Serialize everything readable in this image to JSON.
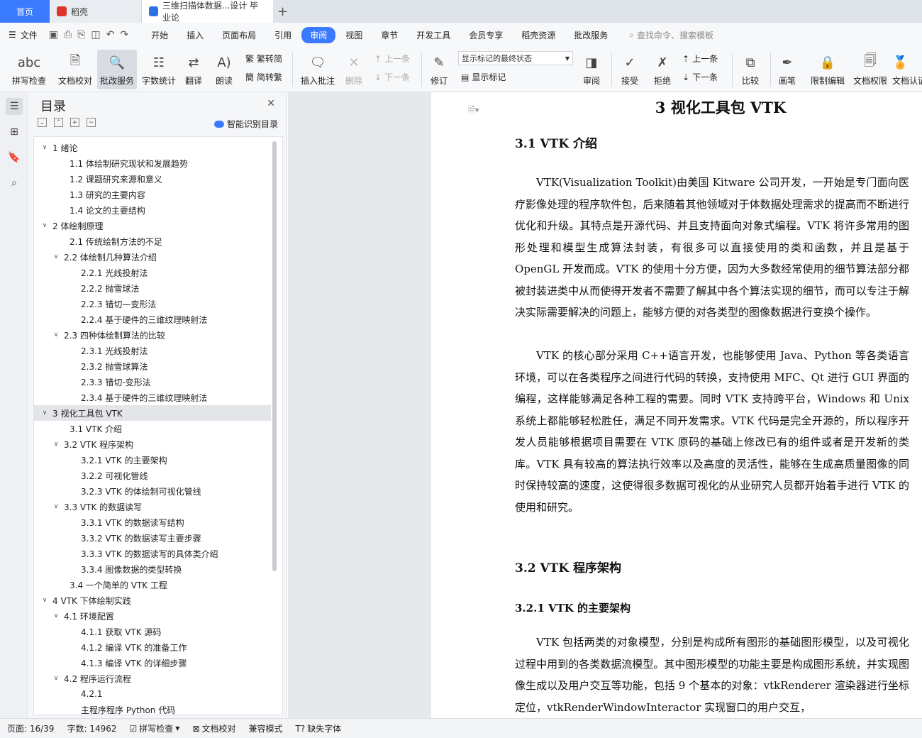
{
  "tabs": {
    "home": "首页",
    "daoke": "稻壳",
    "doc": "三维扫描体数据...设计 毕业论"
  },
  "menu": {
    "file": "文件",
    "items": [
      "开始",
      "插入",
      "页面布局",
      "引用",
      "审阅",
      "视图",
      "章节",
      "开发工具",
      "会员专享",
      "稻壳资源",
      "批改服务"
    ],
    "search": "查找命令、搜索模板"
  },
  "ribbon": {
    "spellcheck": "拼写检查",
    "proofread": "文档校对",
    "grading": "批改服务",
    "wordcount": "字数统计",
    "translate": "翻译",
    "read": "朗读",
    "trad": "繁转简",
    "simp": "简转繁",
    "add_comment": "插入批注",
    "delete": "删除",
    "prev_c": "上一条",
    "next_c": "下一条",
    "revise": "修订",
    "markup_select": "显示标记的最终状态",
    "show_markup": "显示标记",
    "review": "审阅",
    "accept": "接受",
    "reject": "拒绝",
    "prev": "上一条",
    "next": "下一条",
    "compare": "比较",
    "pen": "画笔",
    "restrict": "限制编辑",
    "permission": "文档权限",
    "certify": "文档认证"
  },
  "toc": {
    "title": "目录",
    "smart": "智能识别目录",
    "items": [
      {
        "level": 1,
        "text": "1  绪论",
        "arrow": true
      },
      {
        "level": 2,
        "text": "1.1  体绘制研究现状和发展趋势"
      },
      {
        "level": 2,
        "text": "1.2  课题研究来源和意义"
      },
      {
        "level": 2,
        "text": "1.3  研究的主要内容"
      },
      {
        "level": 2,
        "text": "1.4  论文的主要结构"
      },
      {
        "level": 1,
        "text": "2  体绘制原理",
        "arrow": true
      },
      {
        "level": 2,
        "text": "2.1 传统绘制方法的不足"
      },
      {
        "level": 2,
        "text": "2.2  体绘制几种算法介绍",
        "arrow": true
      },
      {
        "level": 3,
        "text": "2.2.1  光线投射法"
      },
      {
        "level": 3,
        "text": "2.2.2  抛雪球法"
      },
      {
        "level": 3,
        "text": "2.2.3  错切—变形法"
      },
      {
        "level": 3,
        "text": "2.2.4 基于硬件的三维纹理映射法"
      },
      {
        "level": 2,
        "text": "2.3  四种体绘制算法的比较",
        "arrow": true
      },
      {
        "level": 3,
        "text": "2.3.1  光线投射法"
      },
      {
        "level": 3,
        "text": "2.3.2  抛雪球算法"
      },
      {
        "level": 3,
        "text": "2.3.3  错切-变形法"
      },
      {
        "level": 3,
        "text": "2.3.4  基于硬件的三维纹理映射法"
      },
      {
        "level": 1,
        "text": "3  视化工具包 VTK",
        "arrow": true,
        "selected": true
      },
      {
        "level": 2,
        "text": "3.1 VTK 介绍"
      },
      {
        "level": 2,
        "text": "3.2 VTK 程序架构",
        "arrow": true
      },
      {
        "level": 3,
        "text": "3.2.1 VTK 的主要架构"
      },
      {
        "level": 3,
        "text": "3.2.2  可视化管线"
      },
      {
        "level": 3,
        "text": "3.2.3 VTK 的体绘制可视化管线"
      },
      {
        "level": 2,
        "text": "3.3 VTK 的数据读写",
        "arrow": true
      },
      {
        "level": 3,
        "text": "3.3.1 VTK 的数据读写结构"
      },
      {
        "level": 3,
        "text": "3.3.2 VTK 的数据读写主要步骤"
      },
      {
        "level": 3,
        "text": "3.3.3 VTK 的数据读写的具体类介绍"
      },
      {
        "level": 3,
        "text": "3.3.4  图像数据的类型转换"
      },
      {
        "level": 2,
        "text": "3.4  一个简单的 VTK 工程"
      },
      {
        "level": 1,
        "text": "4 VTK 下体绘制实践",
        "arrow": true
      },
      {
        "level": 2,
        "text": "4.1  环境配置",
        "arrow": true
      },
      {
        "level": 3,
        "text": "4.1.1  获取 VTK 源码"
      },
      {
        "level": 3,
        "text": "4.1.2  编译 VTK 的准备工作"
      },
      {
        "level": 3,
        "text": "4.1.3  编译 VTK 的详细步骤"
      },
      {
        "level": 2,
        "text": "4.2  程序运行流程",
        "arrow": true
      },
      {
        "level": 3,
        "text": "4.2.1"
      },
      {
        "level": 3,
        "text": "主程序程序 Python 代码"
      }
    ]
  },
  "doc": {
    "h1": "3  视化工具包 VTK",
    "h2_1": "3.1 VTK 介绍",
    "p1": "VTK(Visualization Toolkit)由美国 Kitware 公司开发，一开始是专门面向医疗影像处理的程序软件包，后来随着其他领域对于体数据处理需求的提高而不断进行优化和升级。其特点是开源代码、并且支持面向对象式编程。VTK 将许多常用的图形处理和模型生成算法封装，有很多可以直接使用的类和函数，并且是基于 OpenGL 开发而成。VTK 的使用十分方便，因为大多数经常使用的细节算法部分都被封装进类中从而使得开发者不需要了解其中各个算法实现的细节，而可以专注于解决实际需要解决的问题上，能够方便的对各类型的图像数据进行变换个操作。",
    "p2": "VTK 的核心部分采用 C++语言开发，也能够使用 Java、Python 等各类语言环境，可以在各类程序之间进行代码的转换，支持使用 MFC、Qt 进行 GUI 界面的编程，这样能够满足各种工程的需要。同时 VTK 支持跨平台，Windows 和 Unix 系统上都能够轻松胜任，满足不同开发需求。VTK 代码是完全开源的，所以程序开发人员能够根据项目需要在 VTK 原码的基础上修改已有的组件或者是开发新的类库。VTK 具有较高的算法执行效率以及高度的灵活性，能够在生成高质量图像的同时保持较高的速度，这使得很多数据可视化的从业研究人员都开始着手进行 VTK 的使用和研究。",
    "h2_2": "3.2 VTK 程序架构",
    "h3_1": "3.2.1 VTK 的主要架构",
    "p3": "VTK 包括两类的对象模型，分别是构成所有图形的基础图形模型，以及可视化过程中用到的各类数据流模型。其中图形模型的功能主要是构成图形系统，并实现图像生成以及用户交互等功能，包括 9 个基本的对象：vtkRenderer 渲染器进行坐标定位，vtkRenderWindowInteractor 实现窗口的用户交互，"
  },
  "status": {
    "page": "页面: 16/39",
    "words": "字数: 14962",
    "spell": "拼写检查",
    "proof": "文档校对",
    "compat": "兼容模式",
    "font": "缺失字体"
  }
}
